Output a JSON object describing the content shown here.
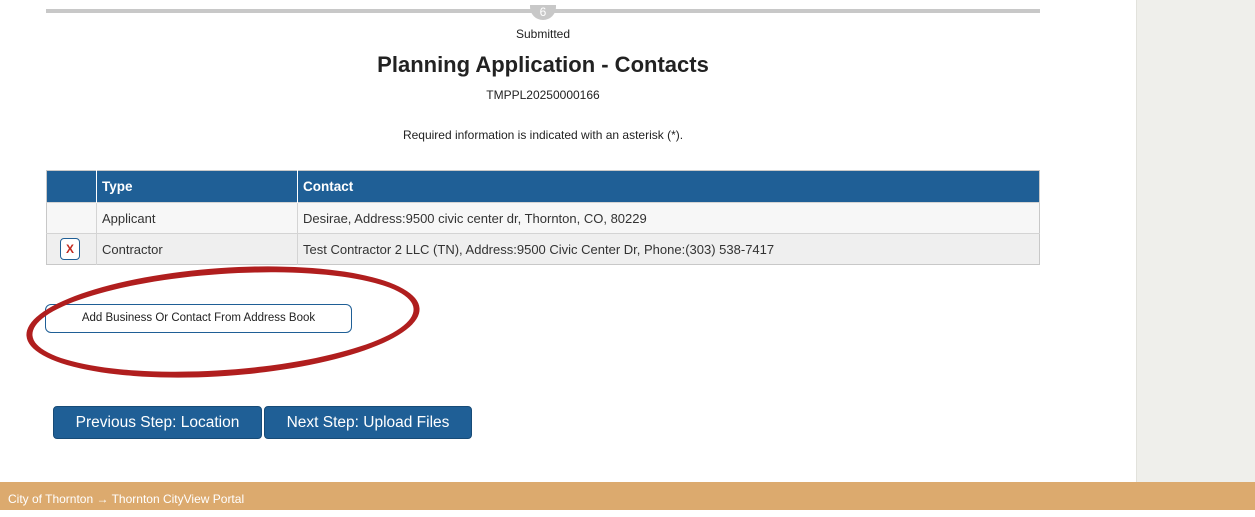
{
  "progress": {
    "current_step": "6",
    "step_label": "Submitted"
  },
  "page": {
    "title": "Planning Application - Contacts",
    "reference": "TMPPL20250000166",
    "required_note": "Required information is indicated with an asterisk (*)."
  },
  "contacts_table": {
    "headers": [
      "",
      "Type",
      "Contact"
    ],
    "rows": [
      {
        "remove": "",
        "type": "Applicant",
        "contact": "Desirae, Address:9500 civic center dr, Thornton, CO, 80229"
      },
      {
        "remove": "X",
        "type": "Contractor",
        "contact": "Test Contractor 2 LLC (TN), Address:9500 Civic Center Dr, Phone:(303) 538-7417"
      }
    ]
  },
  "actions": {
    "add_contact_label": "Add Business Or Contact From Address Book",
    "previous_label": "Previous Step: Location",
    "next_label": "Next Step: Upload Files"
  },
  "footer": {
    "breadcrumb": "City of Thornton → Thornton CityView Portal"
  },
  "colors": {
    "header_blue": "#1f5f96",
    "footer_tan": "#dcaa6e",
    "highlight_red": "#b01e1e"
  }
}
